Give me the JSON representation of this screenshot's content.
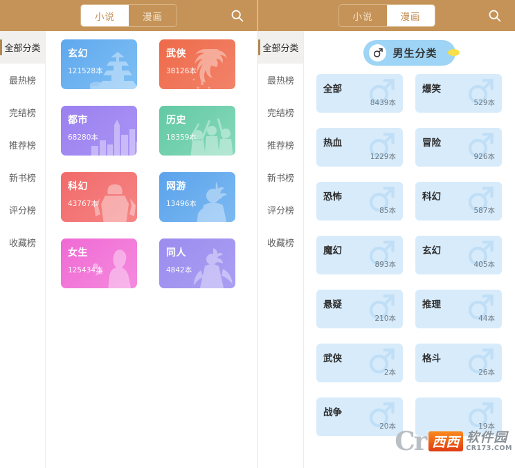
{
  "left_panel": {
    "header": {
      "tabs": [
        {
          "label": "小说",
          "active": true
        },
        {
          "label": "漫画",
          "active": false
        }
      ],
      "search_icon": "search-icon"
    },
    "sidebar": {
      "items": [
        {
          "label": "全部分类",
          "active": true
        },
        {
          "label": "最热榜",
          "active": false
        },
        {
          "label": "完结榜",
          "active": false
        },
        {
          "label": "推荐榜",
          "active": false
        },
        {
          "label": "新书榜",
          "active": false
        },
        {
          "label": "评分榜",
          "active": false
        },
        {
          "label": "收藏榜",
          "active": false
        }
      ]
    },
    "categories": [
      {
        "title": "玄幻",
        "count": "121528本",
        "color_start": "#5fa8ee",
        "color_end": "#7fc0f4",
        "art": "pagoda"
      },
      {
        "title": "武侠",
        "count": "38126本",
        "color_start": "#ee6a4a",
        "color_end": "#f2836a",
        "art": "warrior"
      },
      {
        "title": "都市",
        "count": "68280本",
        "color_start": "#9b80ef",
        "color_end": "#a994f5",
        "art": "city"
      },
      {
        "title": "历史",
        "count": "18359本",
        "color_start": "#62c9a4",
        "color_end": "#87d9ba",
        "art": "army"
      },
      {
        "title": "科幻",
        "count": "43767本",
        "color_start": "#f26a6a",
        "color_end": "#f58585",
        "art": "robot"
      },
      {
        "title": "网游",
        "count": "13496本",
        "color_start": "#5ba3ec",
        "color_end": "#7cb9f1",
        "art": "gamer"
      },
      {
        "title": "女生",
        "count": "125434本",
        "color_start": "#f06ad4",
        "color_end": "#f48ade",
        "art": "girl"
      },
      {
        "title": "同人",
        "count": "4842本",
        "color_start": "#9b8cee",
        "color_end": "#aa9ef3",
        "art": "fairy"
      }
    ]
  },
  "right_panel": {
    "header": {
      "tabs": [
        {
          "label": "小说",
          "active": false
        },
        {
          "label": "漫画",
          "active": true
        }
      ],
      "search_icon": "search-icon"
    },
    "sidebar": {
      "items": [
        {
          "label": "全部分类",
          "active": true
        },
        {
          "label": "最热榜",
          "active": false
        },
        {
          "label": "完结榜",
          "active": false
        },
        {
          "label": "推荐榜",
          "active": false
        },
        {
          "label": "新书榜",
          "active": false
        },
        {
          "label": "评分榜",
          "active": false
        },
        {
          "label": "收藏榜",
          "active": false
        }
      ]
    },
    "section_pill": {
      "label": "男生分类",
      "icon": "male-symbol-icon",
      "bg_color": "#9ed4f5",
      "dot_color": "#f7e04a"
    },
    "categories": [
      {
        "title": "全部",
        "count": "8439本"
      },
      {
        "title": "爆笑",
        "count": "529本"
      },
      {
        "title": "热血",
        "count": "1229本"
      },
      {
        "title": "冒险",
        "count": "926本"
      },
      {
        "title": "恐怖",
        "count": "85本"
      },
      {
        "title": "科幻",
        "count": "587本"
      },
      {
        "title": "魔幻",
        "count": "893本"
      },
      {
        "title": "玄幻",
        "count": "405本"
      },
      {
        "title": "悬疑",
        "count": "210本"
      },
      {
        "title": "推理",
        "count": "44本"
      },
      {
        "title": "武侠",
        "count": "2本"
      },
      {
        "title": "格斗",
        "count": "26本"
      },
      {
        "title": "战争",
        "count": "20本"
      },
      {
        "title": "",
        "count": "19本"
      }
    ]
  },
  "watermark": {
    "logo_text": "Cr",
    "brand_cn": "软件园",
    "brand_red": "西西",
    "url": "CR173.COM"
  },
  "theme": {
    "header_bg": "#c59358",
    "header_text": "#f2e3cd",
    "active_tab_text": "#c08a4c",
    "sidebar_active_bg": "#f2f0ee",
    "sidebar_accent": "#b0884f",
    "minicard_bg": "#d7ebfb"
  }
}
